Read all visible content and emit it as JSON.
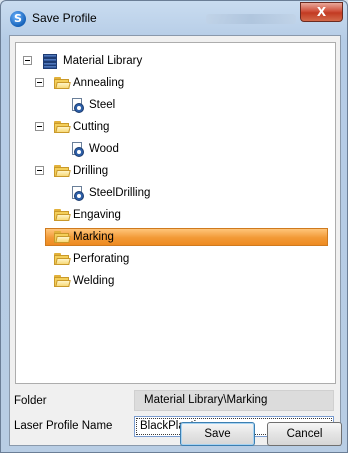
{
  "window": {
    "title": "Save Profile",
    "close_label": "X",
    "app_icon_letter": "S"
  },
  "tree": {
    "root": {
      "label": "Material Library",
      "icon": "library-icon"
    },
    "nodes": [
      {
        "label": "Annealing",
        "icon": "folder-icon",
        "children": [
          {
            "label": "Steel",
            "icon": "profile-icon"
          }
        ]
      },
      {
        "label": "Cutting",
        "icon": "folder-icon",
        "children": [
          {
            "label": "Wood",
            "icon": "profile-icon"
          }
        ]
      },
      {
        "label": "Drilling",
        "icon": "folder-icon",
        "children": [
          {
            "label": "SteelDrilling",
            "icon": "profile-icon"
          }
        ]
      },
      {
        "label": "Engaving",
        "icon": "folder-icon"
      },
      {
        "label": "Marking",
        "icon": "folder-icon",
        "selected": true
      },
      {
        "label": "Perforating",
        "icon": "folder-icon"
      },
      {
        "label": "Welding",
        "icon": "folder-icon"
      }
    ]
  },
  "form": {
    "folder_label": "Folder",
    "folder_value": "Material Library\\Marking",
    "name_label": "Laser Profile Name",
    "name_value": "BlackPlastic"
  },
  "buttons": {
    "save": "Save",
    "cancel": "Cancel"
  },
  "colors": {
    "selection": "#f29a36",
    "close_button": "#c23a22",
    "folder": "#f4cf5a"
  }
}
